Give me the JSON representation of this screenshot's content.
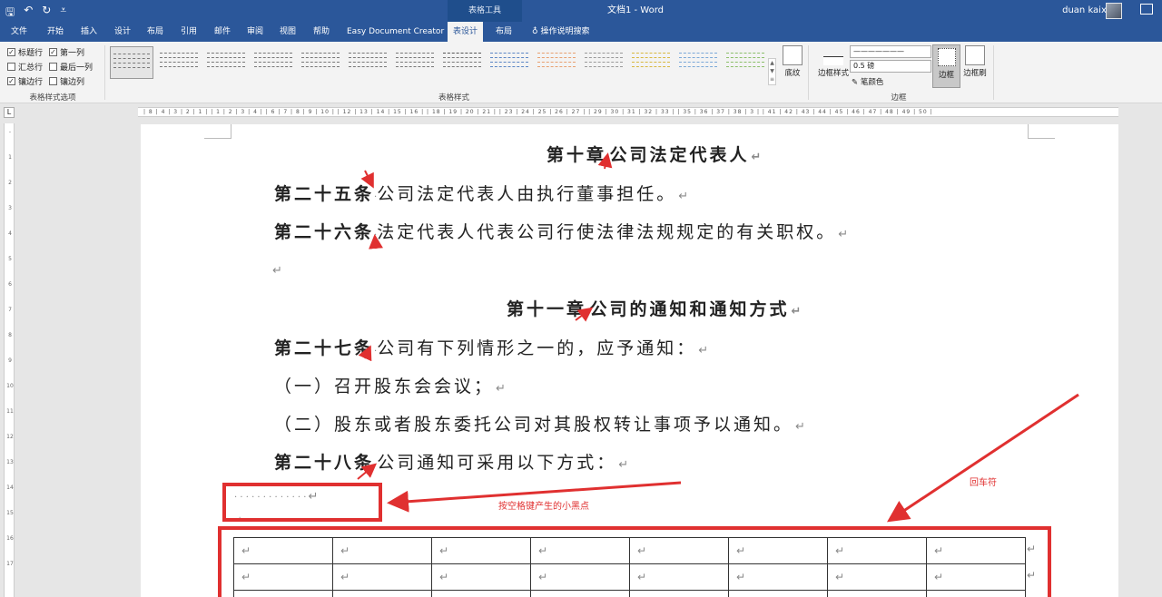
{
  "titlebar": {
    "context_group": "表格工具",
    "doc_title": "文档1  -  Word",
    "user": "duan kaixin"
  },
  "tabs": [
    "文件",
    "开始",
    "插入",
    "设计",
    "布局",
    "引用",
    "邮件",
    "审阅",
    "视图",
    "帮助",
    "Easy Document Creator",
    "表设计",
    "布局",
    "操作说明搜索"
  ],
  "ribbon": {
    "options": {
      "header_row": "标题行",
      "first_column": "第一列",
      "total_row": "汇总行",
      "last_column": "最后一列",
      "banded_rows": "镶边行",
      "banded_columns": "镶边列",
      "group_label": "表格样式选项"
    },
    "styles_group_label": "表格样式",
    "shading_label": "底纹",
    "border_styles_label": "边框样式",
    "pen_weight": "0.5 磅",
    "pen_color_label": "笔颜色",
    "borders_label": "边框",
    "border_painter_label": "边框刷",
    "borders_group_label": "边框"
  },
  "ruler_text": "| 8 | 4 | 3 | 2 | 1 |  | 1 | 2 | 3 | 4 |  | 6 | 7 | 8 | 9 | 10 |  | 12 | 13 | 14 | 15 | 16 |  | 18 | 19 | 20 | 21 |  | 23 | 24 | 25 | 26 | 27 |  | 29 | 30 | 31 | 32 | 33 |  | 35 | 36 | 37 | 38 | 3 |  | 41 | 42 | 43 | 44 | 45 | 46 | 47 | 48 | 49 | 50 |",
  "document": {
    "chapter10": {
      "label": "第十章",
      "title": "公司法定代表人"
    },
    "art25": {
      "label": "第二十五条",
      "text": "公司法定代表人由执行董事担任。"
    },
    "art26": {
      "label": "第二十六条",
      "text": "法定代表人代表公司行使法律法规规定的有关职权。"
    },
    "chapter11": {
      "label": "第十一章",
      "title": "公司的通知和通知方式"
    },
    "art27": {
      "label": "第二十七条",
      "text": "公司有下列情形之一的，应予通知："
    },
    "item1": "（一）召开股东会会议；",
    "item2": "（二）股东或者股东委托公司对其股权转让事项予以通知。",
    "art28": {
      "label": "第二十八条",
      "text": "公司通知可采用以下方式："
    },
    "space_dots": "· · · · · · · · · · · · ·",
    "para_mark": "↵"
  },
  "annotations": {
    "dots_label": "按空格键产生的小黑点",
    "return_label": "回车符"
  },
  "table": {
    "rows": 2,
    "cols": 8,
    "cell_mark": "↵"
  },
  "colors": {
    "word_blue": "#2b579a",
    "annotation_red": "#e03030"
  }
}
